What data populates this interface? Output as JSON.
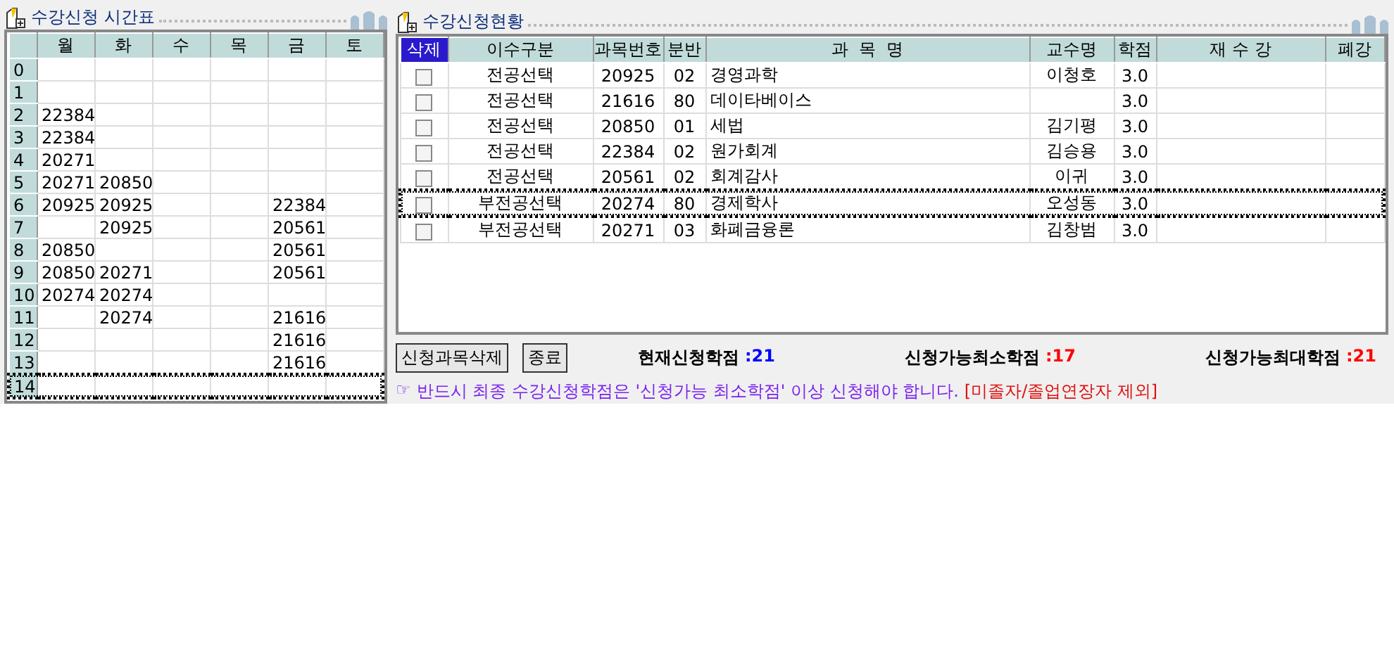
{
  "timetable": {
    "title": "수강신청 시간표",
    "columns": [
      "월",
      "화",
      "수",
      "목",
      "금",
      "토"
    ],
    "rows": [
      {
        "period": "0",
        "cells": [
          "",
          "",
          "",
          "",
          "",
          ""
        ],
        "selected": false
      },
      {
        "period": "1",
        "cells": [
          "",
          "",
          "",
          "",
          "",
          ""
        ],
        "selected": false
      },
      {
        "period": "2",
        "cells": [
          "22384",
          "",
          "",
          "",
          "",
          ""
        ],
        "selected": false
      },
      {
        "period": "3",
        "cells": [
          "22384",
          "",
          "",
          "",
          "",
          ""
        ],
        "selected": false
      },
      {
        "period": "4",
        "cells": [
          "20271",
          "",
          "",
          "",
          "",
          ""
        ],
        "selected": false
      },
      {
        "period": "5",
        "cells": [
          "20271",
          "20850",
          "",
          "",
          "",
          ""
        ],
        "selected": false
      },
      {
        "period": "6",
        "cells": [
          "20925",
          "20925",
          "",
          "",
          "22384",
          ""
        ],
        "selected": false
      },
      {
        "period": "7",
        "cells": [
          "",
          "20925",
          "",
          "",
          "20561",
          ""
        ],
        "selected": false
      },
      {
        "period": "8",
        "cells": [
          "20850",
          "",
          "",
          "",
          "20561",
          ""
        ],
        "selected": false
      },
      {
        "period": "9",
        "cells": [
          "20850",
          "20271",
          "",
          "",
          "20561",
          ""
        ],
        "selected": false
      },
      {
        "period": "10",
        "cells": [
          "20274",
          "20274",
          "",
          "",
          "",
          ""
        ],
        "selected": false
      },
      {
        "period": "11",
        "cells": [
          "",
          "20274",
          "",
          "",
          "21616",
          ""
        ],
        "selected": false
      },
      {
        "period": "12",
        "cells": [
          "",
          "",
          "",
          "",
          "21616",
          ""
        ],
        "selected": false
      },
      {
        "period": "13",
        "cells": [
          "",
          "",
          "",
          "",
          "21616",
          ""
        ],
        "selected": false
      },
      {
        "period": "14",
        "cells": [
          "",
          "",
          "",
          "",
          "",
          ""
        ],
        "selected": true
      }
    ]
  },
  "registration": {
    "title": "수강신청현황",
    "columns": [
      "삭제",
      "이수구분",
      "과목번호",
      "분반",
      "과  목  명",
      "교수명",
      "학점",
      "재 수 강",
      "폐강"
    ],
    "rows": [
      {
        "checked": false,
        "selected": false,
        "category": "전공선택",
        "code": "20925",
        "section": "02",
        "course": "경영과학",
        "professor": "이청호",
        "credits": "3.0"
      },
      {
        "checked": false,
        "selected": false,
        "category": "전공선택",
        "code": "21616",
        "section": "80",
        "course": "데이타베이스",
        "professor": "",
        "credits": "3.0"
      },
      {
        "checked": false,
        "selected": false,
        "category": "전공선택",
        "code": "20850",
        "section": "01",
        "course": "세법",
        "professor": "김기평",
        "credits": "3.0"
      },
      {
        "checked": false,
        "selected": false,
        "category": "전공선택",
        "code": "22384",
        "section": "02",
        "course": "원가회계",
        "professor": "김승용",
        "credits": "3.0"
      },
      {
        "checked": false,
        "selected": false,
        "category": "전공선택",
        "code": "20561",
        "section": "02",
        "course": "회계감사",
        "professor": "이귀",
        "credits": "3.0"
      },
      {
        "checked": false,
        "selected": true,
        "category": "부전공선택",
        "code": "20274",
        "section": "80",
        "course": "경제학사",
        "professor": "오성동",
        "credits": "3.0"
      },
      {
        "checked": false,
        "selected": false,
        "category": "부전공선택",
        "code": "20271",
        "section": "03",
        "course": "화폐금융론",
        "professor": "김창범",
        "credits": "3.0"
      }
    ]
  },
  "buttons": [
    "신청과목삭제",
    "종료"
  ],
  "summary": [
    {
      "label": "현재신청학점",
      "value": ":21",
      "color": "#0000ff"
    },
    {
      "label": "신청가능최소학점",
      "value": ":17",
      "color": "#ff0000"
    },
    {
      "label": "신청가능최대학점",
      "value": ":21",
      "color": "#ff0000"
    }
  ],
  "notice": {
    "marker": "☞",
    "text": "반드시 최종 수강신청학점은 '신청가능 최소학점' 이상 신청해야 합니다.",
    "note": "[미졸자/졸업연장자 제외]"
  }
}
